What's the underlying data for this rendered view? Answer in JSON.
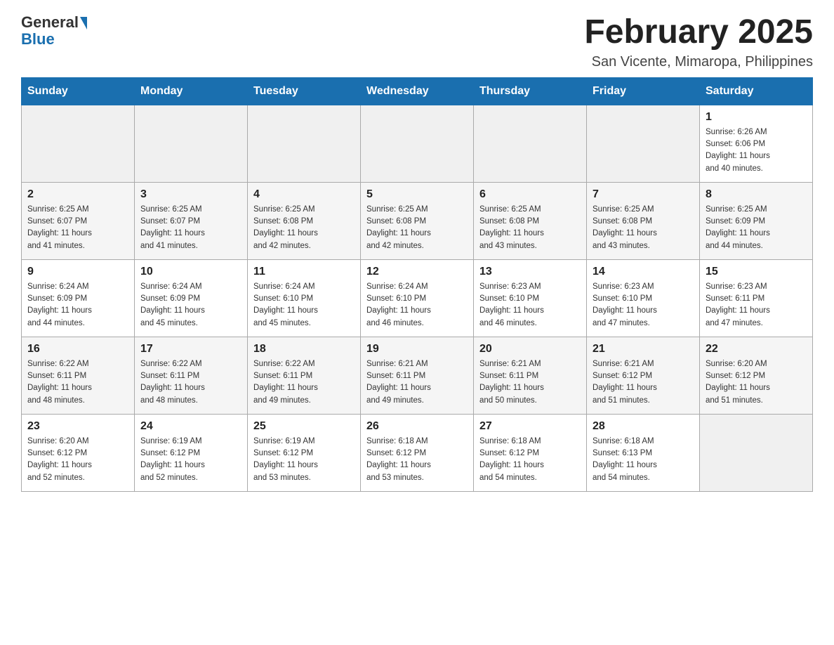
{
  "logo": {
    "general": "General",
    "blue": "Blue"
  },
  "title": "February 2025",
  "subtitle": "San Vicente, Mimaropa, Philippines",
  "weekdays": [
    "Sunday",
    "Monday",
    "Tuesday",
    "Wednesday",
    "Thursday",
    "Friday",
    "Saturday"
  ],
  "weeks": [
    [
      {
        "day": "",
        "info": ""
      },
      {
        "day": "",
        "info": ""
      },
      {
        "day": "",
        "info": ""
      },
      {
        "day": "",
        "info": ""
      },
      {
        "day": "",
        "info": ""
      },
      {
        "day": "",
        "info": ""
      },
      {
        "day": "1",
        "info": "Sunrise: 6:26 AM\nSunset: 6:06 PM\nDaylight: 11 hours\nand 40 minutes."
      }
    ],
    [
      {
        "day": "2",
        "info": "Sunrise: 6:25 AM\nSunset: 6:07 PM\nDaylight: 11 hours\nand 41 minutes."
      },
      {
        "day": "3",
        "info": "Sunrise: 6:25 AM\nSunset: 6:07 PM\nDaylight: 11 hours\nand 41 minutes."
      },
      {
        "day": "4",
        "info": "Sunrise: 6:25 AM\nSunset: 6:08 PM\nDaylight: 11 hours\nand 42 minutes."
      },
      {
        "day": "5",
        "info": "Sunrise: 6:25 AM\nSunset: 6:08 PM\nDaylight: 11 hours\nand 42 minutes."
      },
      {
        "day": "6",
        "info": "Sunrise: 6:25 AM\nSunset: 6:08 PM\nDaylight: 11 hours\nand 43 minutes."
      },
      {
        "day": "7",
        "info": "Sunrise: 6:25 AM\nSunset: 6:08 PM\nDaylight: 11 hours\nand 43 minutes."
      },
      {
        "day": "8",
        "info": "Sunrise: 6:25 AM\nSunset: 6:09 PM\nDaylight: 11 hours\nand 44 minutes."
      }
    ],
    [
      {
        "day": "9",
        "info": "Sunrise: 6:24 AM\nSunset: 6:09 PM\nDaylight: 11 hours\nand 44 minutes."
      },
      {
        "day": "10",
        "info": "Sunrise: 6:24 AM\nSunset: 6:09 PM\nDaylight: 11 hours\nand 45 minutes."
      },
      {
        "day": "11",
        "info": "Sunrise: 6:24 AM\nSunset: 6:10 PM\nDaylight: 11 hours\nand 45 minutes."
      },
      {
        "day": "12",
        "info": "Sunrise: 6:24 AM\nSunset: 6:10 PM\nDaylight: 11 hours\nand 46 minutes."
      },
      {
        "day": "13",
        "info": "Sunrise: 6:23 AM\nSunset: 6:10 PM\nDaylight: 11 hours\nand 46 minutes."
      },
      {
        "day": "14",
        "info": "Sunrise: 6:23 AM\nSunset: 6:10 PM\nDaylight: 11 hours\nand 47 minutes."
      },
      {
        "day": "15",
        "info": "Sunrise: 6:23 AM\nSunset: 6:11 PM\nDaylight: 11 hours\nand 47 minutes."
      }
    ],
    [
      {
        "day": "16",
        "info": "Sunrise: 6:22 AM\nSunset: 6:11 PM\nDaylight: 11 hours\nand 48 minutes."
      },
      {
        "day": "17",
        "info": "Sunrise: 6:22 AM\nSunset: 6:11 PM\nDaylight: 11 hours\nand 48 minutes."
      },
      {
        "day": "18",
        "info": "Sunrise: 6:22 AM\nSunset: 6:11 PM\nDaylight: 11 hours\nand 49 minutes."
      },
      {
        "day": "19",
        "info": "Sunrise: 6:21 AM\nSunset: 6:11 PM\nDaylight: 11 hours\nand 49 minutes."
      },
      {
        "day": "20",
        "info": "Sunrise: 6:21 AM\nSunset: 6:11 PM\nDaylight: 11 hours\nand 50 minutes."
      },
      {
        "day": "21",
        "info": "Sunrise: 6:21 AM\nSunset: 6:12 PM\nDaylight: 11 hours\nand 51 minutes."
      },
      {
        "day": "22",
        "info": "Sunrise: 6:20 AM\nSunset: 6:12 PM\nDaylight: 11 hours\nand 51 minutes."
      }
    ],
    [
      {
        "day": "23",
        "info": "Sunrise: 6:20 AM\nSunset: 6:12 PM\nDaylight: 11 hours\nand 52 minutes."
      },
      {
        "day": "24",
        "info": "Sunrise: 6:19 AM\nSunset: 6:12 PM\nDaylight: 11 hours\nand 52 minutes."
      },
      {
        "day": "25",
        "info": "Sunrise: 6:19 AM\nSunset: 6:12 PM\nDaylight: 11 hours\nand 53 minutes."
      },
      {
        "day": "26",
        "info": "Sunrise: 6:18 AM\nSunset: 6:12 PM\nDaylight: 11 hours\nand 53 minutes."
      },
      {
        "day": "27",
        "info": "Sunrise: 6:18 AM\nSunset: 6:12 PM\nDaylight: 11 hours\nand 54 minutes."
      },
      {
        "day": "28",
        "info": "Sunrise: 6:18 AM\nSunset: 6:13 PM\nDaylight: 11 hours\nand 54 minutes."
      },
      {
        "day": "",
        "info": ""
      }
    ]
  ]
}
